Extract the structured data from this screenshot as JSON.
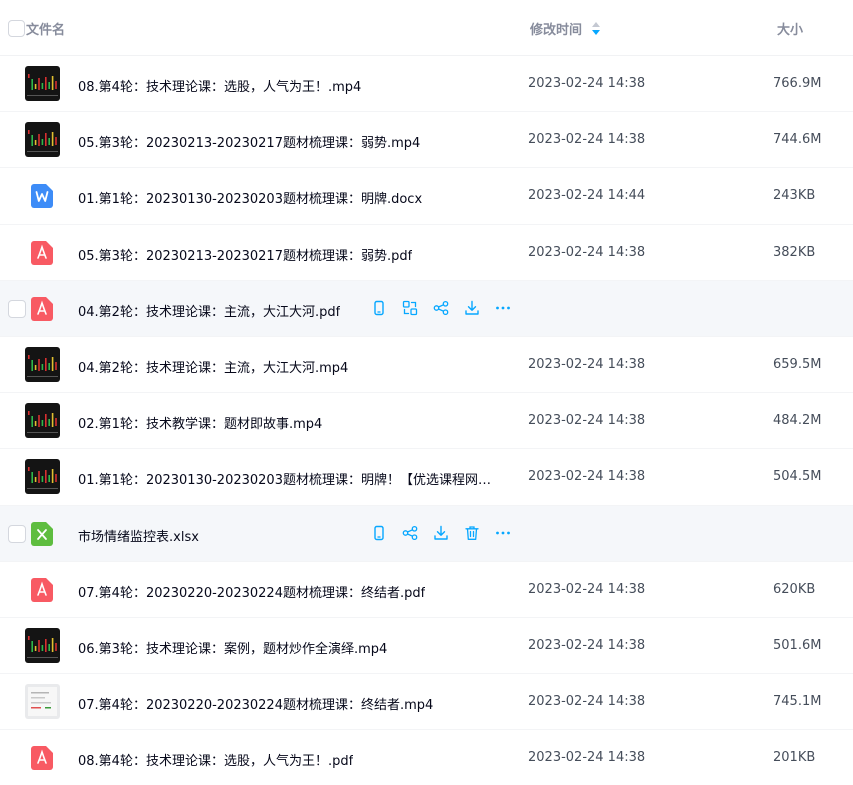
{
  "header": {
    "name_label": "文件名",
    "time_label": "修改时间",
    "size_label": "大小"
  },
  "colors": {
    "accent": "#06a7ff",
    "pdf": "#f85a63",
    "word": "#3d8cf7",
    "excel": "#5ebd3f",
    "hover_bg": "#f5f7fa"
  },
  "files": [
    {
      "name": "08.第4轮：技术理论课：选股，人气为王！.mp4",
      "time": "2023-02-24 14:38",
      "size": "766.9M",
      "kind": "video-thumb"
    },
    {
      "name": "05.第3轮：20230213-20230217题材梳理课：弱势.mp4",
      "time": "2023-02-24 14:38",
      "size": "744.6M",
      "kind": "video-thumb"
    },
    {
      "name": "01.第1轮：20230130-20230203题材梳理课：明牌.docx",
      "time": "2023-02-24 14:44",
      "size": "243KB",
      "kind": "word-icon"
    },
    {
      "name": "05.第3轮：20230213-20230217题材梳理课：弱势.pdf",
      "time": "2023-02-24 14:38",
      "size": "382KB",
      "kind": "pdf-icon"
    },
    {
      "name": "04.第2轮：技术理论课：主流，大江大河.pdf",
      "time": "",
      "size": "",
      "kind": "pdf-icon",
      "hover": true
    },
    {
      "name": "04.第2轮：技术理论课：主流，大江大河.mp4",
      "time": "2023-02-24 14:38",
      "size": "659.5M",
      "kind": "video-thumb"
    },
    {
      "name": "02.第1轮：技术教学课：题材即故事.mp4",
      "time": "2023-02-24 14:38",
      "size": "484.2M",
      "kind": "video-thumb"
    },
    {
      "name": "01.第1轮：20230130-20230203题材梳理课：明牌！【优选课程网w...",
      "time": "2023-02-24 14:38",
      "size": "504.5M",
      "kind": "video-thumb"
    },
    {
      "name": "市场情绪监控表.xlsx",
      "time": "",
      "size": "",
      "kind": "excel-icon",
      "hover": true
    },
    {
      "name": "07.第4轮：20230220-20230224题材梳理课：终结者.pdf",
      "time": "2023-02-24 14:38",
      "size": "620KB",
      "kind": "pdf-icon"
    },
    {
      "name": "06.第3轮：技术理论课：案例，题材炒作全演绎.mp4",
      "time": "2023-02-24 14:38",
      "size": "501.6M",
      "kind": "video-thumb"
    },
    {
      "name": "07.第4轮：20230220-20230224题材梳理课：终结者.mp4",
      "time": "2023-02-24 14:38",
      "size": "745.1M",
      "kind": "video-thumb-light"
    },
    {
      "name": "08.第4轮：技术理论课：选股，人气为王！.pdf",
      "time": "2023-02-24 14:38",
      "size": "201KB",
      "kind": "pdf-icon"
    }
  ]
}
